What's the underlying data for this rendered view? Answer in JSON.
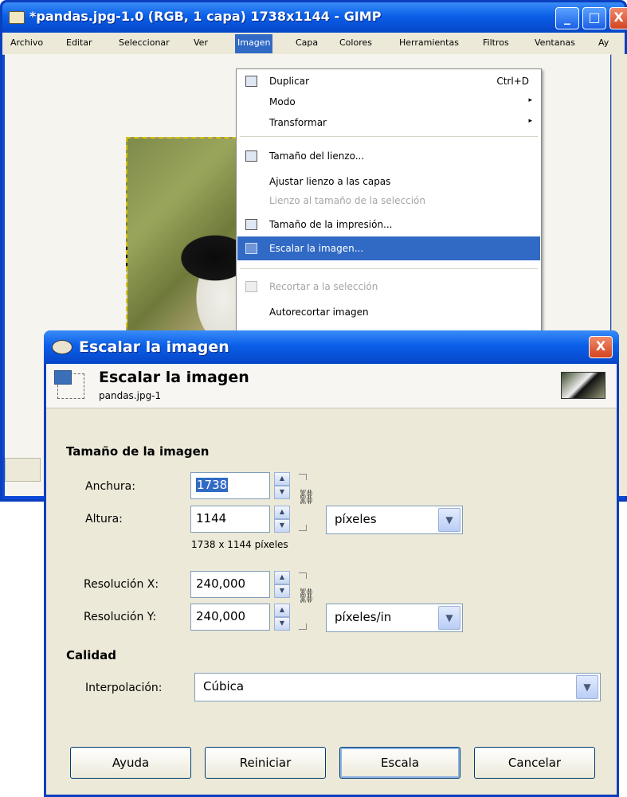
{
  "main_window": {
    "title": "*pandas.jpg-1.0 (RGB, 1 capa) 1738x1144 - GIMP",
    "controls": {
      "minimize": "_",
      "maximize": "□",
      "close": "X"
    },
    "menus": [
      "Archivo",
      "Editar",
      "Seleccionar",
      "Ver",
      "Imagen",
      "Capa",
      "Colores",
      "Herramientas",
      "Filtros",
      "Ventanas",
      "Ay"
    ]
  },
  "image_menu": {
    "items": [
      {
        "label": "Duplicar",
        "shortcut": "Ctrl+D"
      },
      {
        "label": "Modo",
        "submenu": "▸"
      },
      {
        "label": "Transformar",
        "submenu": "▸"
      },
      {
        "label": "Tamaño del lienzo..."
      },
      {
        "label": "Ajustar lienzo a las capas"
      },
      {
        "label": "Lienzo al tamaño de la selección"
      },
      {
        "label": "Tamaño de la impresión..."
      },
      {
        "label": "Escalar la imagen..."
      },
      {
        "label": "Recortar a la selección"
      },
      {
        "label": "Autorecortar imagen"
      }
    ]
  },
  "dialog": {
    "title": "Escalar la imagen",
    "close": "X",
    "header_title": "Escalar la imagen",
    "header_subtitle": "pandas.jpg-1",
    "size_section": "Tamaño de la imagen",
    "width_label": "Anchura:",
    "width_value": "1738",
    "height_label": "Altura:",
    "height_value": "1144",
    "size_unit": "píxeles",
    "size_note": "1738 x 1144 píxeles",
    "res_x_label": "Resolución X:",
    "res_x_value": "240,000",
    "res_y_label": "Resolución Y:",
    "res_y_value": "240,000",
    "res_unit": "píxeles/in",
    "quality_section": "Calidad",
    "interp_label": "Interpolación:",
    "interp_value": "Cúbica",
    "buttons": {
      "help": "Ayuda",
      "reset": "Reiniciar",
      "scale": "Escala",
      "cancel": "Cancelar"
    },
    "spin_up": "▲",
    "spin_down": "▼",
    "dropdown_arrow": "▼"
  }
}
